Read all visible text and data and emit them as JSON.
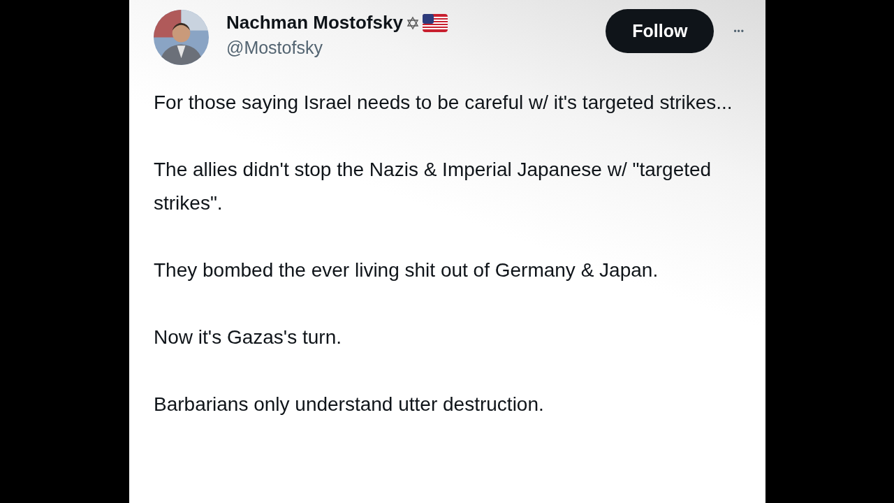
{
  "author": {
    "name": "Nachman Mostofsky",
    "handle": "@Mostofsky"
  },
  "follow_button": "Follow",
  "more_button": "•••",
  "paragraphs": [
    "For those saying Israel needs to be careful w/ it's targeted strikes...",
    "The allies didn't stop the Nazis & Imperial Japanese w/ \"targeted strikes\".",
    "They bombed the ever living shit out of Germany & Japan.",
    "Now it's Gazas's turn.",
    "Barbarians only understand utter destruction."
  ]
}
